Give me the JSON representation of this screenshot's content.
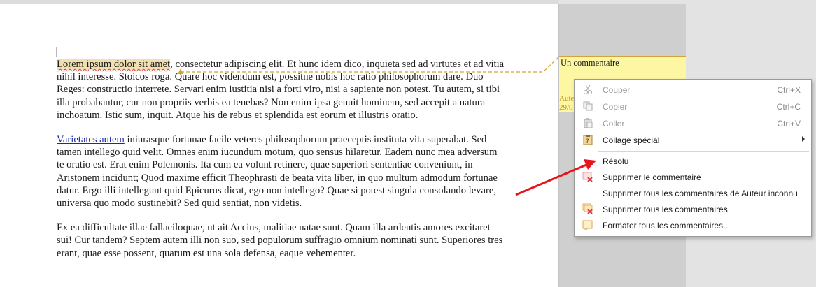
{
  "document": {
    "paragraph1": {
      "highlighted": "Lorem ipsum dolor sit amet",
      "text": ", consectetur adipiscing elit. Et hunc idem dico, inquieta sed ad virtutes et ad vitia nihil interesse. Stoicos roga. Quare hoc videndum est, possitne nobis hoc ratio philosophorum dare. Duo Reges: constructio interrete. Servari enim iustitia nisi a forti viro, nisi a sapiente non potest. Tu autem, si tibi illa probabantur, cur non propriis verbis ea tenebas? Non enim ipsa genuit hominem, sed accepit a natura inchoatum. Istic sum, inquit. Atque his de rebus et splendida est eorum et illustris oratio."
    },
    "paragraph2": {
      "link": "Varietates autem",
      "text": " iniurasque fortunae facile veteres philosophorum praeceptis instituta vita superabat. Sed tamen intellego quid velit. Omnes enim iucundum motum, quo sensus hilaretur. Eadem nunc mea adversum te oratio est. Erat enim Polemonis. Ita cum ea volunt retinere, quae superiori sententiae conveniunt, in Aristonem incidunt; Quod maxime efficit Theophrasti de beata vita liber, in quo multum admodum fortunae datur. Ergo illi intellegunt quid Epicurus dicat, ego non intellego? Quae si potest singula consolando levare, universa quo modo sustinebit? Sed quid sentiat, non videtis."
    },
    "paragraph3": {
      "text": "Ex ea difficultate illae fallaciloquae, ut ait Accius, malitiae natae sunt. Quam illa ardentis amores excitaret sui! Cur tandem? Septem autem illi non suo, sed populorum suffragio omnium nominati sunt. Superiores tres erant, quae esse possent, quarum est una sola defensa, eaque vehementer."
    }
  },
  "comment": {
    "text": "Un commentaire",
    "author_partial": "Aute",
    "date_partial": "29/0"
  },
  "context_menu": {
    "items": [
      {
        "label": "Couper",
        "shortcut": "Ctrl+X",
        "icon": "scissors-icon",
        "enabled": false
      },
      {
        "label": "Copier",
        "shortcut": "Ctrl+C",
        "icon": "copy-icon",
        "enabled": false
      },
      {
        "label": "Coller",
        "shortcut": "Ctrl+V",
        "icon": "paste-icon",
        "enabled": false
      },
      {
        "label": "Collage spécial",
        "icon": "paste-special-icon",
        "enabled": true,
        "submenu": true
      },
      {
        "label": "Résolu",
        "enabled": true
      },
      {
        "label": "Supprimer le commentaire",
        "icon": "delete-comment-icon",
        "enabled": true
      },
      {
        "label": "Supprimer tous les commentaires de Auteur inconnu",
        "enabled": true
      },
      {
        "label": "Supprimer tous les commentaires",
        "icon": "delete-all-comments-icon",
        "enabled": true
      },
      {
        "label": "Formater tous les commentaires...",
        "icon": "format-comments-icon",
        "enabled": true
      }
    ]
  },
  "colors": {
    "comment_bg": "#fdf6a3",
    "comment_anchor_line": "#d3a33a",
    "spellcheck": "#d93a3a",
    "annotation_arrow": "#e8141c"
  }
}
